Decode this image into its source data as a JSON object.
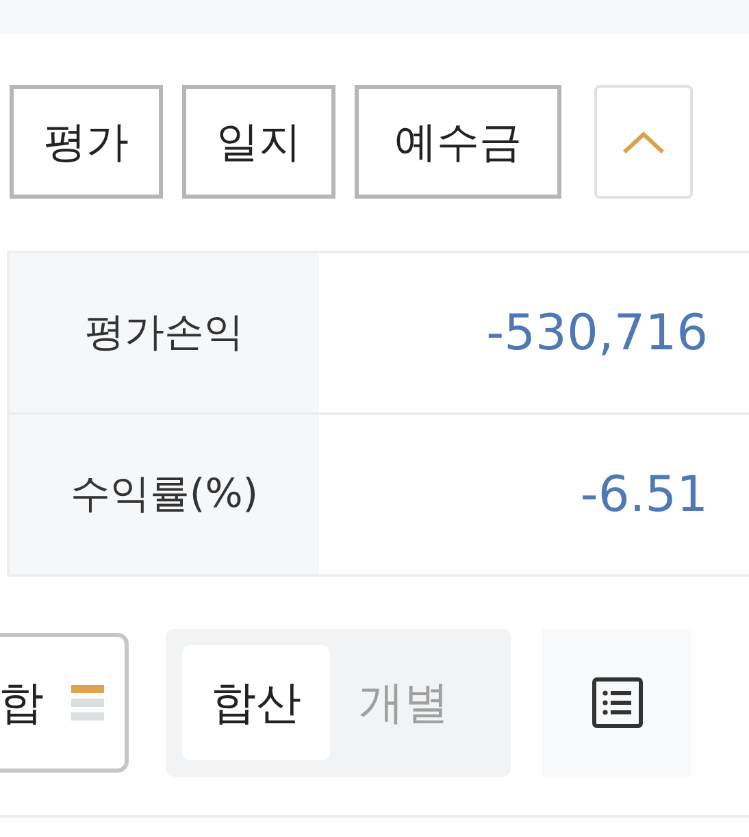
{
  "tabs": [
    {
      "label": "평가",
      "selected": false
    },
    {
      "label": "일지",
      "selected": false
    },
    {
      "label": "예수금",
      "selected": false
    }
  ],
  "collapse": {
    "expanded": true
  },
  "summary": [
    {
      "label": "평가손익",
      "value": "-530,716"
    },
    {
      "label": "수익률(%)",
      "value": "-6.51"
    }
  ],
  "sort_select": {
    "value": "합"
  },
  "view_toggle": [
    {
      "label": "합산",
      "selected": true
    },
    {
      "label": "개별",
      "selected": false
    }
  ]
}
